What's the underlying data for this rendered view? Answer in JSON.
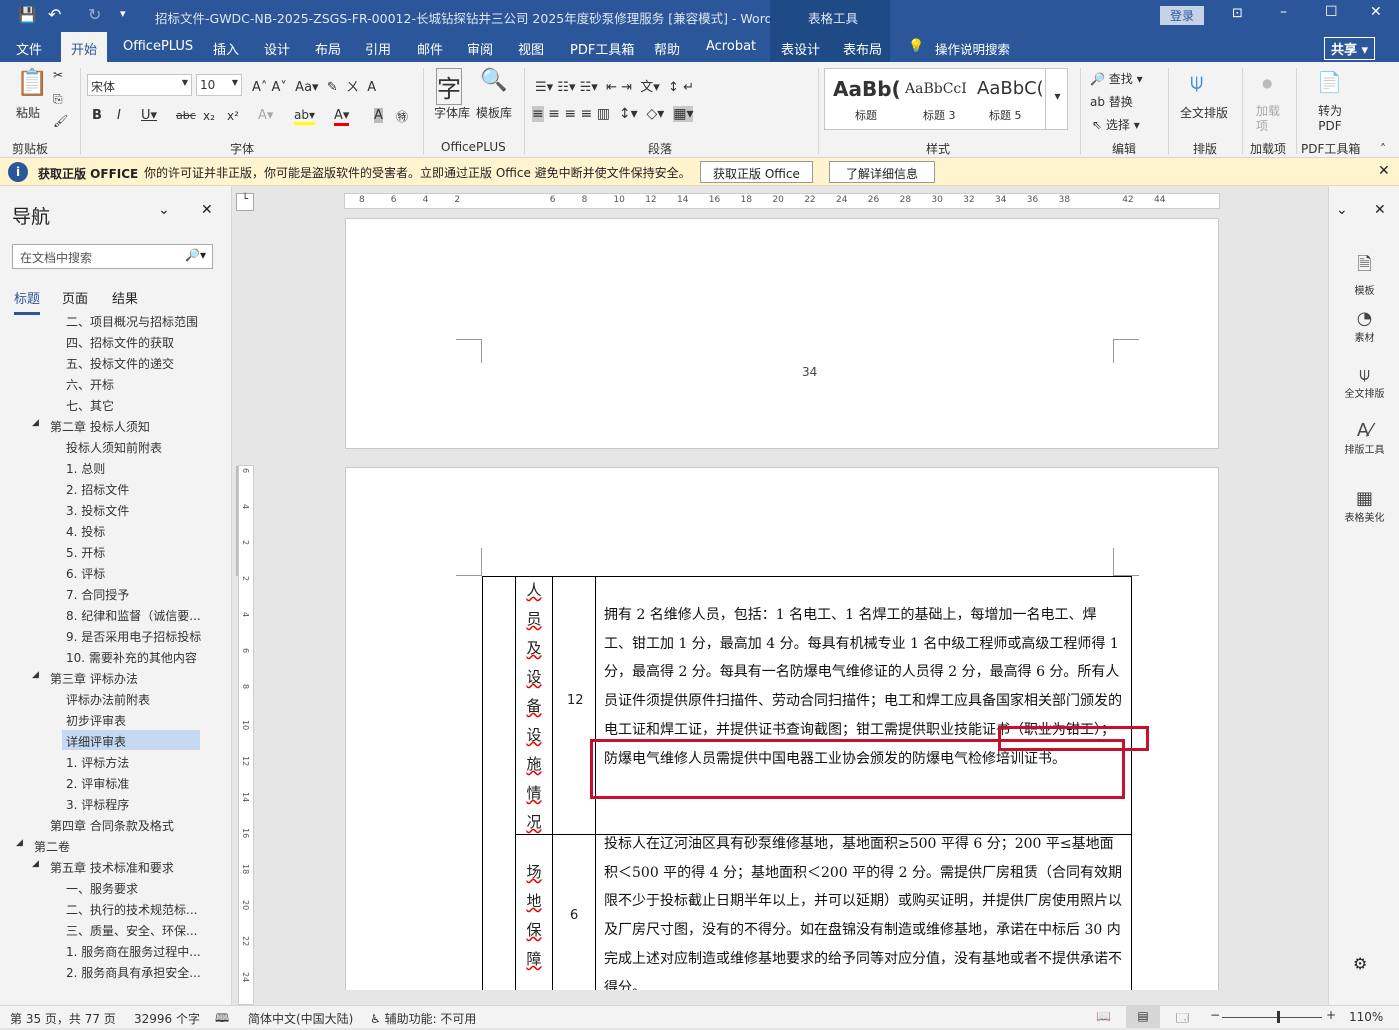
{
  "title": {
    "text": "招标文件-GWDC-NB-2025-ZSGS-FR-00012-长城钻探钻井三公司 2025年度砂泵修理服务 [兼容模式]  -  Word",
    "context": "表格工具",
    "login": "登录"
  },
  "tabs": [
    "文件",
    "开始",
    "OfficePLUS",
    "插入",
    "设计",
    "布局",
    "引用",
    "邮件",
    "审阅",
    "视图",
    "PDF工具箱",
    "帮助",
    "Acrobat",
    "表设计",
    "表布局"
  ],
  "tell_me": "操作说明搜索",
  "share": "共享",
  "ribbon": {
    "paste": "粘贴",
    "font_name": "宋体",
    "font_size": "10",
    "font_lib": "字体库",
    "template_lib": "模板库",
    "styles": [
      {
        "preview": "AaBb(",
        "name": "标题"
      },
      {
        "preview": "AaBbCcI",
        "name": "标题 3"
      },
      {
        "preview": "AaBbC(",
        "name": "标题 5"
      }
    ],
    "find": "查找",
    "replace": "替换",
    "select": "选择",
    "full_layout": "全文排版",
    "addin": "加载项",
    "to_pdf": "转为PDF",
    "groups": [
      "剪贴板",
      "字体",
      "OfficePLUS",
      "段落",
      "样式",
      "编辑",
      "排版",
      "加载项",
      "PDF工具箱"
    ]
  },
  "notice": {
    "title": "获取正版 OFFICE",
    "message": "你的许可证并非正版，你可能是盗版软件的受害者。立即通过正版 Office 避免中断并使文件保持安全。",
    "btn1": "获取正版 Office",
    "btn2": "了解详细信息"
  },
  "nav": {
    "title": "导航",
    "search_placeholder": "在文档中搜索",
    "tabs": [
      "标题",
      "页面",
      "结果"
    ],
    "items": [
      "二、项目概况与招标范围",
      "四、招标文件的获取",
      "五、投标文件的递交",
      "六、开标",
      "七、其它",
      "第二章  投标人须知",
      "投标人须知前附表",
      "1. 总则",
      "2. 招标文件",
      "3. 投标文件",
      "4. 投标",
      "5. 开标",
      "6. 评标",
      "7. 合同授予",
      "8. 纪律和监督（诚信要...",
      "9. 是否采用电子招标投标",
      "10. 需要补充的其他内容",
      "第三章  评标办法",
      "评标办法前附表",
      "初步评审表",
      "详细评审表",
      "1. 评标方法",
      "2. 评审标准",
      "3. 评标程序",
      "第四章  合同条款及格式",
      "第二卷",
      "第五章  技术标准和要求",
      "一、服务要求",
      "二、执行的技术规范标...",
      "三、质量、安全、环保...",
      "1. 服务商在服务过程中...",
      "2. 服务商具有承担安全..."
    ]
  },
  "ruler": [
    "8",
    "6",
    "4",
    "2",
    "",
    "",
    "6",
    "8",
    "10",
    "12",
    "14",
    "16",
    "18",
    "20",
    "22",
    "24",
    "26",
    "28",
    "30",
    "32",
    "34",
    "36",
    "38",
    "",
    "42",
    "44"
  ],
  "vruler": [
    "6",
    "4",
    "2",
    "2",
    "4",
    "6",
    "8",
    "10",
    "12",
    "14",
    "16",
    "18",
    "20",
    "22",
    "24"
  ],
  "doc": {
    "page_number": "34",
    "rows": [
      {
        "item": "人员及设备设施情况",
        "score": "12",
        "text": "拥有 2 名维修人员，包括：1 名电工、1 名焊工的基础上，每增加一名电工、焊工、钳工加 1 分，最高加 4 分。每具有机械专业 1 名中级工程师或高级工程师得 1 分，最高得 2 分。每具有一名防爆电气维修证的人员得 2 分，最高得 6 分。所有人员证件须提供原件扫描件、劳动合同扫描件；电工和焊工应具备国家相关部门颁发的电工证和焊工证，并提供证书查询截图；钳工需提供职业技能证书（职业为钳工）；防爆电气维修人员需提供中国电器工业协会颁发的防爆电气检修培训证书。"
      },
      {
        "item": "场地保障",
        "score": "6",
        "text": "投标人在辽河油区具有砂泵维修基地，基地面积≥500 平得 6 分；200 平≤基地面积＜500 平的得 4 分；基地面积＜200 平的得 2 分。需提供厂房租赁（合同有效期限不少于投标截止日期半年以上，并可以延期）或购买证明，并提供厂房使用照片以及厂房尺寸图，没有的不得分。如在盘锦没有制造或维修基地，承诺在中标后 30 内完成上述对应制造或维修基地要求的给予同等对应分值，没有基地或者不提供承诺不得分。"
      }
    ]
  },
  "right_pane": [
    "模板",
    "素材",
    "全文排版",
    "排版工具",
    "表格美化"
  ],
  "status": {
    "page": "第 35 页，共 77 页",
    "words": "32996 个字",
    "lang": "简体中文(中国大陆)",
    "access": "辅助功能: 不可用",
    "zoom": "110%",
    "zoom_level": 0.55
  },
  "colors": {
    "brand": "#2b579a",
    "highlight": "#c8102e",
    "notice": "#fff4ce"
  }
}
